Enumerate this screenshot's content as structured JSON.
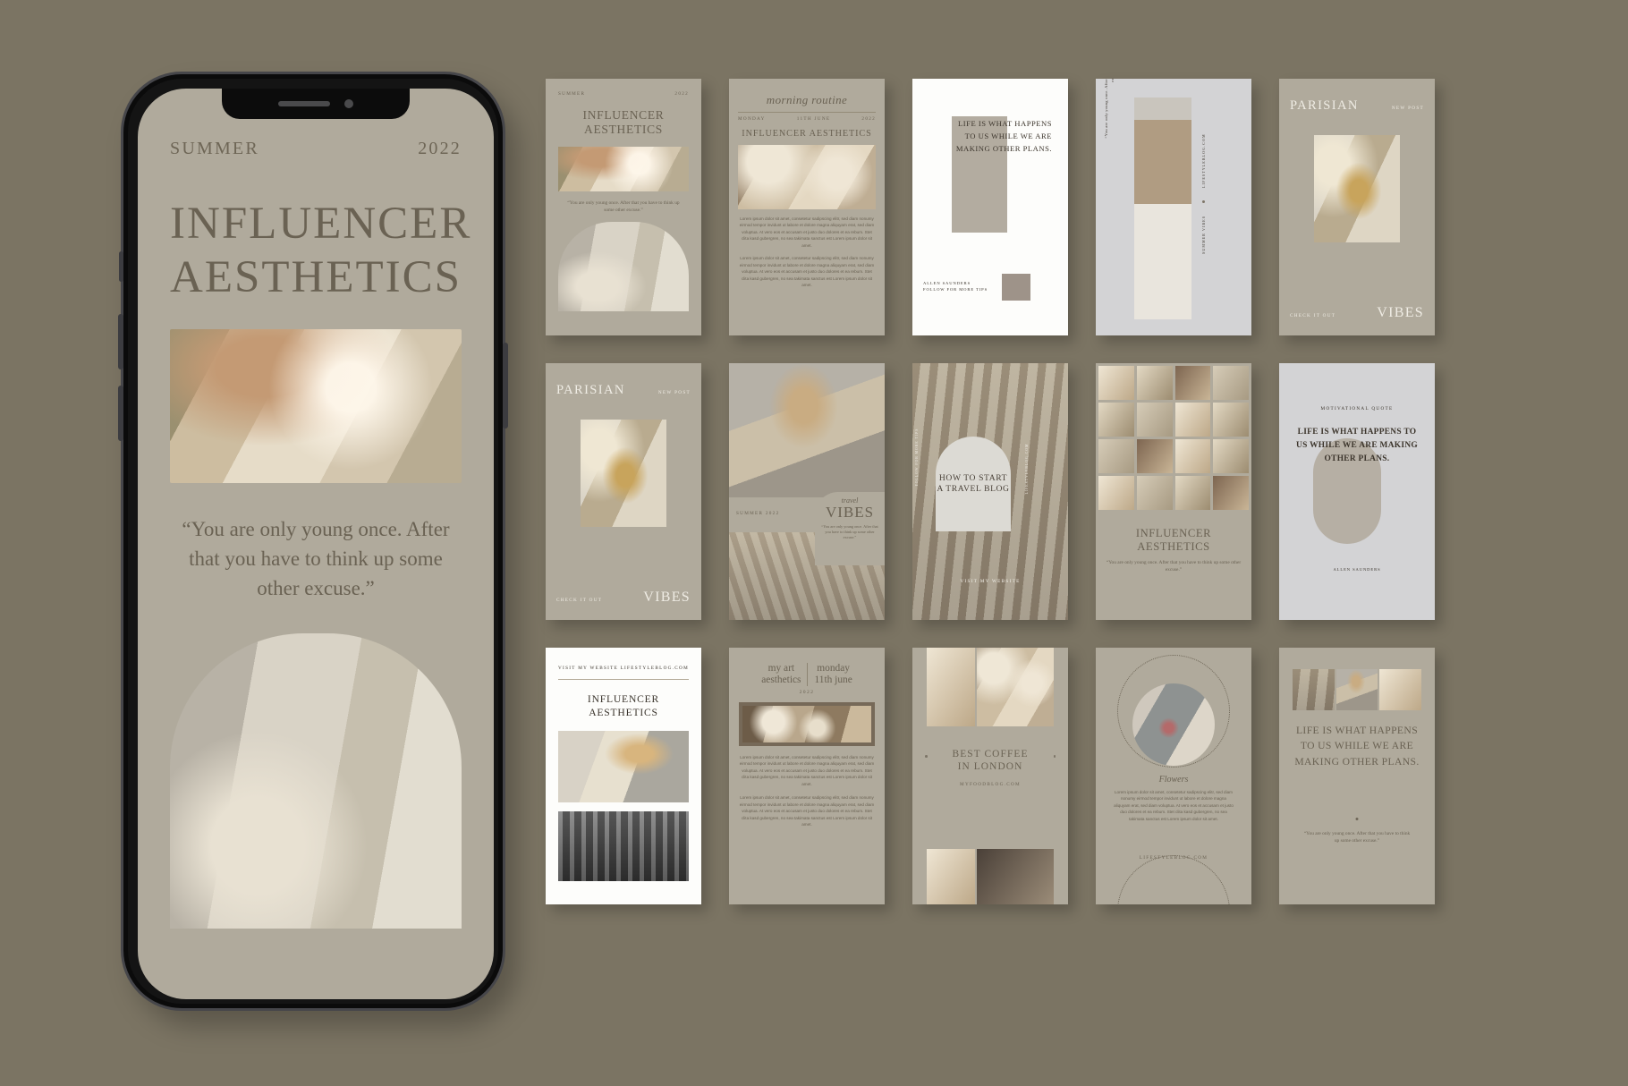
{
  "theme": {
    "canvas_bg": "#7b7463",
    "card_bg": "#b0aa9c",
    "card_white": "#fdfdfb",
    "card_grey": "#d3d3d5",
    "ink": "#6a6253",
    "ink_dark": "#3a342c",
    "light": "#efece4"
  },
  "phone": {
    "label_left": "SUMMER",
    "label_right": "2022",
    "title_line1": "INFLUENCER",
    "title_line2": "AESTHETICS",
    "quote": "“You are only young once. After that you have to think up some other excuse.”"
  },
  "lorem": {
    "p1": "Lorem ipsum dolor sit amet, consetetur sadipscing elitr, sed diam nonumy eirmod tempor invidunt ut labore et dolore magna aliquyam erat, sed diam voluptua. At vero eos et accusam et justo duo dolores et ea rebum. Stet clita kasd gubergren, no sea takimata sanctus est Lorem ipsum dolor sit amet.",
    "p2": "Lorem ipsum dolor sit amet, consetetur sadipscing elitr, sed diam nonumy eirmod tempor invidunt ut labore et dolore magna aliquyam erat, sed diam voluptua. At vero eos et accusam et justo duo dolores et ea rebum. Stet clita kasd gubergren, no sea takimata sanctus est Lorem ipsum dolor sit amet.",
    "short": "Lorem ipsum dolor sit amet, consetetur sadipscing elitr, sed diam nonumy eirmod tempor invidunt ut labore et dolore magna aliquyam erat, sed diam voluptua. At vero eos et accusam et justo duo dolores et ea rebum. Stet clita kasd gubergren, no sea takimata sanctus est Lorem ipsum dolor sit amet."
  },
  "cards": {
    "c1": {
      "label_left": "SUMMER",
      "label_right": "2022",
      "title_line1": "INFLUENCER",
      "title_line2": "AESTHETICS",
      "quote": "“You are only young once. After that you have to think up some other excuse.”"
    },
    "c2": {
      "script": "morning routine",
      "meta_day": "MONDAY",
      "meta_date": "11TH JUNE",
      "meta_year": "2022",
      "heading": "INFLUENCER AESTHETICS"
    },
    "c3": {
      "quote": "LIFE IS WHAT HAPPENS TO US WHILE WE ARE MAKING OTHER PLANS.",
      "credit_name": "ALLEN SAUNDERS",
      "credit_cta": "FOLLOW FOR MORE TIPS"
    },
    "c4": {
      "vertical_quote": "“You are only young once. After that you have to think up some other excuse.”",
      "vertical_left": "SUMMER VIBES",
      "vertical_right": "LIFESTYLEBLOG.COM"
    },
    "c5": {
      "brand": "PARISIAN",
      "new_post": "NEW POST",
      "check_it_out": "CHECK IT OUT",
      "vibes": "VIBES"
    },
    "c6": {
      "brand": "PARISIAN",
      "new_post": "NEW POST",
      "check_it_out": "CHECK IT OUT",
      "vibes": "VIBES"
    },
    "c7": {
      "summer": "SUMMER 2022",
      "script": "travel",
      "vibes": "VIBES",
      "quote": "“You are only young once. After that you have to think up some other excuse.”"
    },
    "c8": {
      "arch_text": "HOW TO START A TRAVEL BLOG",
      "visit": "VISIT MY WEBSITE",
      "vertical_left": "FOLLOW FOR MORE TIPS",
      "vertical_right": "LIFESTYLEBLOG.COM"
    },
    "c9": {
      "title_line1": "INFLUENCER",
      "title_line2": "AESTHETICS",
      "quote": "“You are only young once. After that you have to think up some other excuse.”"
    },
    "c10": {
      "eyebrow": "MOTIVATIONAL QUOTE",
      "quote": "LIFE IS WHAT HAPPENS TO US WHILE WE ARE MAKING OTHER PLANS.",
      "credit": "ALLEN SAUNDERS"
    },
    "c11": {
      "visit": "VISIT MY WEBSITE",
      "url": "LIFESTYLEBLOG.COM",
      "title_line1": "INFLUENCER",
      "title_line2": "AESTHETICS"
    },
    "c12": {
      "left_line1": "my art",
      "left_line2": "aesthetics",
      "right_line1": "monday",
      "right_line2": "11th june",
      "year": "2022"
    },
    "c13": {
      "title_line1": "BEST COFFEE",
      "title_line2": "IN LONDON",
      "url": "MYFOODBLOG.COM"
    },
    "c14": {
      "title": "Flowers",
      "url": "LIFESTYLEBLOG.COM"
    },
    "c15": {
      "quote": "LIFE IS WHAT HAPPENS TO US WHILE WE ARE MAKING OTHER PLANS.",
      "sub_quote": "“You are only young once. After that you have to think up some other excuse.”"
    }
  }
}
